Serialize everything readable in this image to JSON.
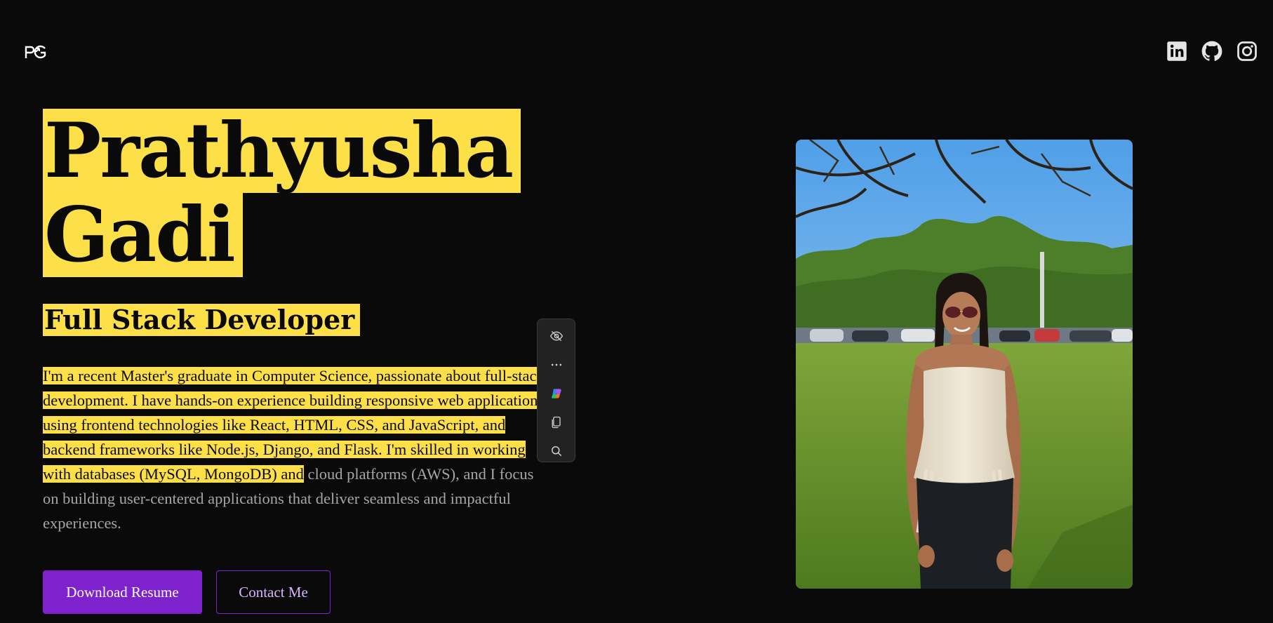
{
  "header": {
    "logo_text": "PG",
    "social": [
      {
        "name": "LinkedIn",
        "icon": "linkedin-icon"
      },
      {
        "name": "GitHub",
        "icon": "github-icon"
      },
      {
        "name": "Instagram",
        "icon": "instagram-icon"
      }
    ]
  },
  "hero": {
    "first_name": "Prathyusha",
    "last_name": "Gadi",
    "role": "Full Stack Developer",
    "bio_selected": "I'm a recent Master's graduate in Computer Science, passionate about full-stack development. I have hands-on experience building responsive web applications using frontend technologies like React, HTML, CSS, and JavaScript, and backend frameworks like Node.js, Django, and Flask. I'm skilled in working with databases (MySQL, MongoDB) and",
    "bio_rest": " cloud platforms (AWS), and I focus on building user-centered applications that deliver seamless and impactful experiences.",
    "download_label": "Download Resume",
    "contact_label": "Contact Me"
  },
  "selection_toolbar": {
    "items": [
      "eye-off-icon",
      "more-icon",
      "copilot-icon",
      "copy-icon",
      "search-icon"
    ]
  },
  "colors": {
    "background": "#0a0a0a",
    "highlight": "#fde047",
    "accent": "#7e22ce",
    "accent_light": "#d8b4fe",
    "muted_text": "#a6a6a6"
  }
}
